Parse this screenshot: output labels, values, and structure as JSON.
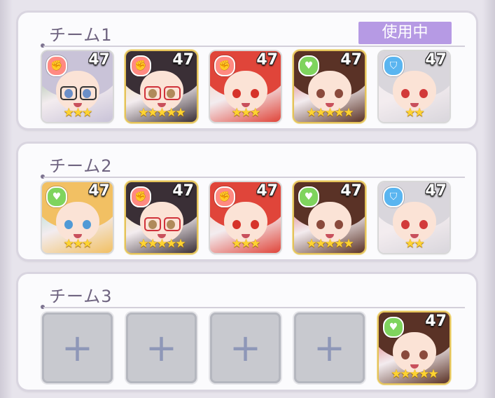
{
  "teams": [
    {
      "title": "チーム1",
      "badge": "使用中",
      "members": [
        {
          "role": "atk",
          "level": "47",
          "stars": 3,
          "hair": "#c9c3d8",
          "eye": "#6a8fc8",
          "glasses": "#333",
          "accent": "#7aa67a"
        },
        {
          "role": "atk",
          "level": "47",
          "stars": 5,
          "hair": "#3a2f36",
          "eye": "#b08a5a",
          "glasses": "#d0323a",
          "accent": "#f3d98a"
        },
        {
          "role": "atk",
          "level": "47",
          "stars": 3,
          "hair": "#e0453a",
          "eye": "#d6332a",
          "glasses": "",
          "accent": "#f7c2a6"
        },
        {
          "role": "sup",
          "level": "47",
          "stars": 5,
          "hair": "#5a3226",
          "eye": "#8a4a3c",
          "glasses": "",
          "accent": "#d23c3c"
        },
        {
          "role": "def",
          "level": "47",
          "stars": 2,
          "hair": "#d9d6dc",
          "eye": "#d23a3a",
          "glasses": "",
          "accent": "#eee"
        }
      ]
    },
    {
      "title": "チーム2",
      "badge": "",
      "members": [
        {
          "role": "sup",
          "level": "47",
          "stars": 3,
          "hair": "#f2c063",
          "eye": "#4f9ad6",
          "glasses": "",
          "accent": "#8fd6c0"
        },
        {
          "role": "atk",
          "level": "47",
          "stars": 5,
          "hair": "#3a2f36",
          "eye": "#b08a5a",
          "glasses": "#d0323a",
          "accent": "#f3d98a"
        },
        {
          "role": "atk",
          "level": "47",
          "stars": 3,
          "hair": "#e0453a",
          "eye": "#d6332a",
          "glasses": "",
          "accent": "#f7c2a6"
        },
        {
          "role": "sup",
          "level": "47",
          "stars": 5,
          "hair": "#5a3226",
          "eye": "#8a4a3c",
          "glasses": "",
          "accent": "#d23c3c"
        },
        {
          "role": "def",
          "level": "47",
          "stars": 2,
          "hair": "#d9d6dc",
          "eye": "#d23a3a",
          "glasses": "",
          "accent": "#eee"
        }
      ]
    },
    {
      "title": "チーム3",
      "badge": "",
      "members": [
        {
          "empty": true,
          "plus": "+"
        },
        {
          "empty": true,
          "plus": "+"
        },
        {
          "empty": true,
          "plus": "+"
        },
        {
          "empty": true,
          "plus": "+"
        },
        {
          "role": "sup",
          "level": "47",
          "stars": 5,
          "hair": "#5a3226",
          "eye": "#8a4a3c",
          "glasses": "",
          "accent": "#d23c3c"
        }
      ]
    }
  ],
  "role_icons": {
    "atk": "attack-fist-icon",
    "sup": "support-heart-icon",
    "def": "defense-shield-icon"
  },
  "role_glyphs": {
    "atk": "✊",
    "sup": "♥",
    "def": "⛉"
  },
  "star_glyph": "★"
}
